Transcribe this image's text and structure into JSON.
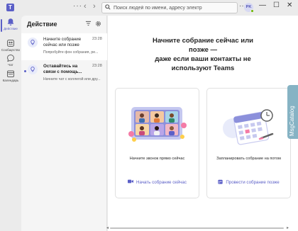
{
  "titlebar": {
    "search_placeholder": "Поиск людей по имени, адресу электр",
    "avatar_initials": "PK",
    "more_label": "···",
    "min_label": "—",
    "max_label": "☐",
    "close_label": "✕"
  },
  "rail": {
    "items": [
      {
        "label": "Действие",
        "icon": "bell-icon",
        "active": true
      },
      {
        "label": "Сообщество",
        "icon": "community-icon",
        "active": false
      },
      {
        "label": "Чат",
        "icon": "chat-icon",
        "active": false
      },
      {
        "label": "Календарь",
        "icon": "calendar-icon",
        "active": false
      }
    ]
  },
  "pane": {
    "title": "Действие",
    "items": [
      {
        "title": "Начните собрание сейчас или позже",
        "time": "23:28",
        "preview": "Попробуйте фон собрания, ре...",
        "unread": false,
        "selected": true
      },
      {
        "title": "Оставайтесь на связи с помощь...",
        "time": "23:28",
        "preview": "Начните чат с коллегой или дру...",
        "unread": true,
        "selected": false
      }
    ]
  },
  "main": {
    "hero_line1": "Начните собрание сейчас или",
    "hero_line2": "позже —",
    "hero_line3": "даже если ваши контакты не",
    "hero_line4": "используют Teams",
    "cards": [
      {
        "caption": "Начните звонок прямо сейчас",
        "button": "Начать собрание сейчас",
        "icon": "video-camera-icon"
      },
      {
        "caption": "Запланировать собрание на потом",
        "button": "Провести собрание позже",
        "icon": "calendar-icon"
      }
    ]
  },
  "side_tab": {
    "label": "MsgCatalog",
    "color": "#86b3c4"
  },
  "colors": {
    "accent": "#5b5fc7",
    "background": "#ebebeb"
  }
}
